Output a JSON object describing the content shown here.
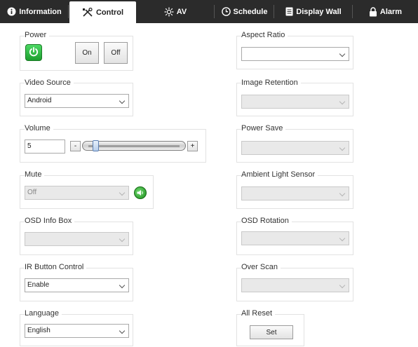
{
  "tabs": [
    {
      "label": "Information",
      "icon": "info-icon"
    },
    {
      "label": "Control",
      "icon": "tools-icon"
    },
    {
      "label": "AV",
      "icon": "brightness-icon"
    },
    {
      "label": "Schedule",
      "icon": "clock-icon"
    },
    {
      "label": "Display Wall",
      "icon": "document-icon"
    },
    {
      "label": "Alarm",
      "icon": "lock-icon"
    }
  ],
  "active_tab": "Control",
  "left": {
    "power": {
      "label": "Power",
      "on_label": "On",
      "off_label": "Off"
    },
    "video_source": {
      "label": "Video Source",
      "value": "Android"
    },
    "volume": {
      "label": "Volume",
      "value": "5",
      "minus": "-",
      "plus": "+",
      "level": 0.05
    },
    "mute": {
      "label": "Mute",
      "value": "Off"
    },
    "osd_info_box": {
      "label": "OSD Info Box",
      "value": ""
    },
    "ir_button_control": {
      "label": "IR Button Control",
      "value": "Enable"
    },
    "language": {
      "label": "Language",
      "value": "English"
    }
  },
  "right": {
    "aspect_ratio": {
      "label": "Aspect Ratio",
      "value": ""
    },
    "image_retention": {
      "label": "Image Retention",
      "value": ""
    },
    "power_save": {
      "label": "Power Save",
      "value": ""
    },
    "ambient_light_sensor": {
      "label": "Ambient Light Sensor",
      "value": ""
    },
    "osd_rotation": {
      "label": "OSD Rotation",
      "value": ""
    },
    "over_scan": {
      "label": "Over Scan",
      "value": ""
    },
    "all_reset": {
      "label": "All Reset",
      "button": "Set"
    }
  },
  "colors": {
    "tabbar": "#2b2b2b",
    "power_green": "#2bbf3e",
    "group_border": "#e2e2e2"
  }
}
